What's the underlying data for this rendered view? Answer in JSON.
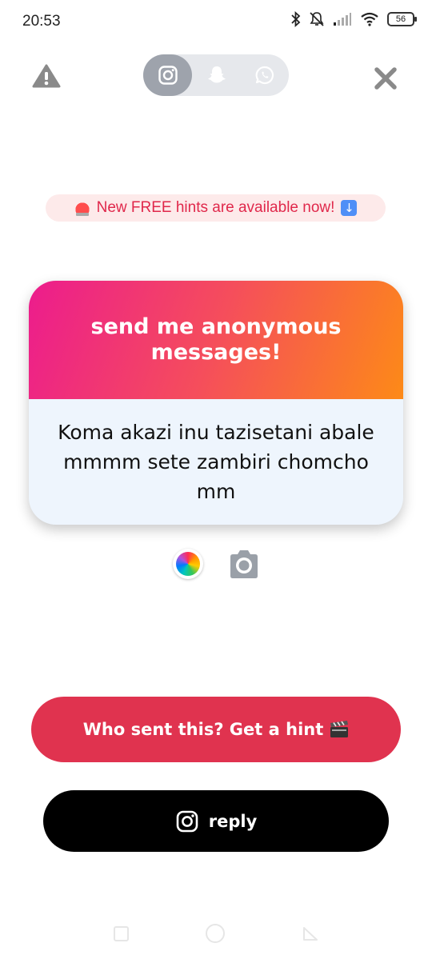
{
  "status_bar": {
    "time": "20:53",
    "battery": "56"
  },
  "banner": {
    "text": "New FREE hints are available now!"
  },
  "card": {
    "header": "send me anonymous messages!",
    "message": "Koma akazi inu tazisetani abale mmmm sete zambiri chomcho mm"
  },
  "buttons": {
    "hint": "Who sent this? Get a hint",
    "reply": "reply"
  },
  "colors": {
    "accent": "#e0334f",
    "banner_text": "#e0284b",
    "gradient_start": "#ec1c8d",
    "gradient_end": "#fd8a17"
  },
  "icons": [
    "warning-icon",
    "instagram-icon",
    "snapchat-icon",
    "whatsapp-icon",
    "close-icon",
    "color-wheel-icon",
    "camera-icon",
    "siren-emoji",
    "down-arrow-emoji",
    "clapper-emoji"
  ]
}
